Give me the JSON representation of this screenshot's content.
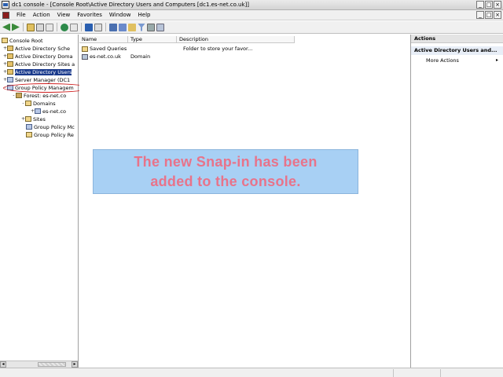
{
  "window": {
    "title": "dc1 console - [Console Root\\Active Directory Users and Computers [dc1.es-net.co.uk]]",
    "buttons": [
      "_",
      "□",
      "×"
    ]
  },
  "menubar": {
    "items": [
      "File",
      "Action",
      "View",
      "Favorites",
      "Window",
      "Help"
    ],
    "inner_buttons": [
      "_",
      "□",
      "×"
    ]
  },
  "tree": {
    "root": "Console Root",
    "items": [
      {
        "label": "Active Directory Sche",
        "expander": "+"
      },
      {
        "label": "Active Directory Doma",
        "expander": "+"
      },
      {
        "label": "Active Directory Sites a",
        "expander": "+"
      },
      {
        "label": "Active Directory Users",
        "expander": "+",
        "selected": true
      },
      {
        "label": "Server Manager (DC1",
        "expander": "+"
      },
      {
        "label": "Group Policy Managem",
        "expander": "-"
      },
      {
        "label": "Forest: es-net.co",
        "expander": "-"
      },
      {
        "label": "Domains",
        "expander": "-"
      },
      {
        "label": "es-net.co",
        "expander": "+"
      },
      {
        "label": "Sites",
        "expander": "+"
      },
      {
        "label": "Group Policy Mc",
        "expander": ""
      },
      {
        "label": "Group Policy Re",
        "expander": ""
      }
    ]
  },
  "list": {
    "columns": [
      "Name",
      "Type",
      "Description"
    ],
    "rows": [
      {
        "name": "Saved Queries",
        "type": "",
        "description": "Folder to store your favor..."
      },
      {
        "name": "es-net.co.uk",
        "type": "Domain",
        "description": ""
      }
    ]
  },
  "actions": {
    "title": "Actions",
    "section": "Active Directory Users and...",
    "more": "More Actions"
  },
  "callout": {
    "text": "The new Snap-in has been\nadded to the console.",
    "background": "#a8d0f4",
    "color": "#e8738a"
  },
  "colors": {
    "selection": "#1a3a8c",
    "highlight_oval": "#d02020"
  }
}
